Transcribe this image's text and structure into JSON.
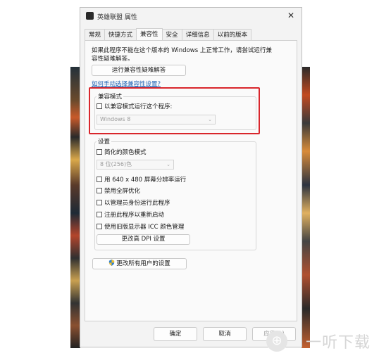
{
  "window": {
    "title": "英雄联盟 属性",
    "close_glyph": "✕"
  },
  "tabs": [
    "常规",
    "快捷方式",
    "兼容性",
    "安全",
    "详细信息",
    "以前的版本"
  ],
  "active_tab": "兼容性",
  "intro": "如果此程序不能在这个版本的 Windows 上正常工作，请尝试运行兼容性疑难解答。",
  "troubleshoot_button": "运行兼容性疑难解答",
  "manual_link": "如何手动选择兼容性设置?",
  "compat_mode": {
    "title": "兼容模式",
    "checkbox_label": "以兼容模式运行这个程序:",
    "select_value": "Windows 8"
  },
  "settings": {
    "title": "设置",
    "reduced_color": "简化的颜色模式",
    "color_select": "8 位(256)色",
    "res_640": "用 640 x 480 屏幕分辨率运行",
    "disable_fullscreen": "禁用全屏优化",
    "run_as_admin": "以管理员身份运行此程序",
    "register_restart": "注册此程序以重新启动",
    "legacy_icc": "使用旧版显示器 ICC 颜色管理",
    "dpi_button": "更改高 DPI 设置"
  },
  "all_users_button": "更改所有用户的设置",
  "footer": {
    "ok": "确定",
    "cancel": "取消",
    "apply": "应用(A)"
  },
  "watermark": "一听下载",
  "colors": {
    "highlight": "#d9262c",
    "link": "#1a5fb4"
  }
}
